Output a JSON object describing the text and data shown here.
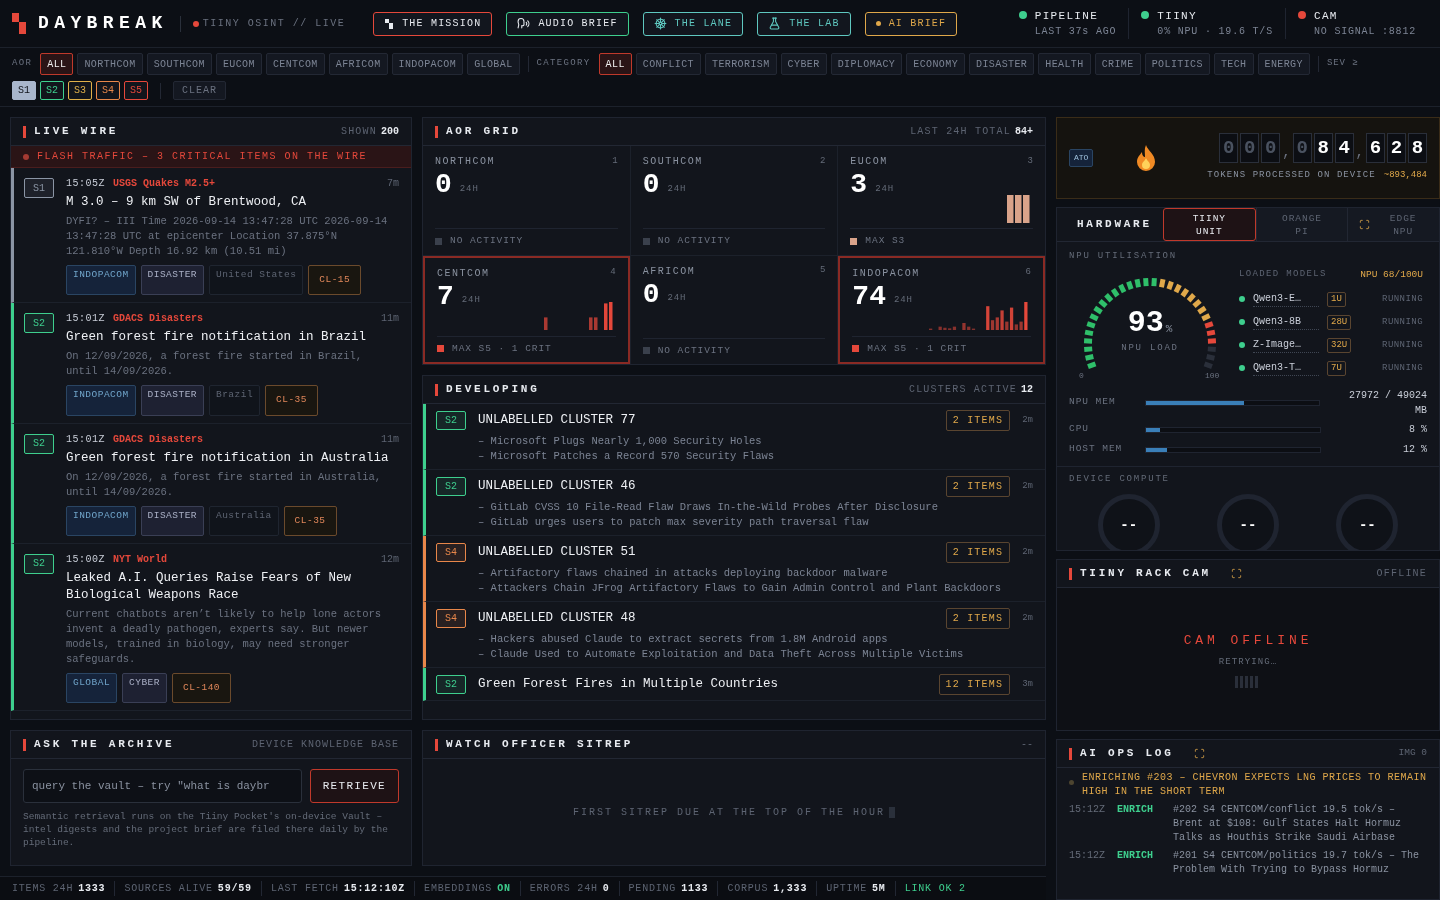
{
  "header": {
    "brand": "DAYBREAK",
    "tagline": "TIINY OSINT // LIVE",
    "nav": [
      {
        "label": "THE MISSION",
        "kind": "mission",
        "color": "#e5483b"
      },
      {
        "label": "AUDIO BRIEF",
        "kind": "audio",
        "color": "#3ecf8e"
      },
      {
        "label": "THE LANE",
        "kind": "lane",
        "color": "#5fc8c0"
      },
      {
        "label": "THE LAB",
        "kind": "lab",
        "color": "#5fc8c0"
      },
      {
        "label": "AI BRIEF",
        "kind": "brief",
        "color": "#e0a84a"
      }
    ],
    "status": [
      {
        "name": "PIPELINE",
        "detail": "LAST 37s AGO",
        "color": "#3ecf8e"
      },
      {
        "name": "TIINY",
        "detail": "0% NPU · 19.6 T/S",
        "color": "#3ecf8e"
      },
      {
        "name": "CAM",
        "detail": "NO SIGNAL :8812",
        "color": "#e5483b"
      }
    ]
  },
  "filters": {
    "aor_label": "AOR",
    "aor": [
      {
        "label": "ALL",
        "selected": true
      },
      {
        "label": "NORTHCOM",
        "selected": false
      },
      {
        "label": "SOUTHCOM",
        "selected": false
      },
      {
        "label": "EUCOM",
        "selected": false
      },
      {
        "label": "CENTCOM",
        "selected": false
      },
      {
        "label": "AFRICOM",
        "selected": false
      },
      {
        "label": "INDOPACOM",
        "selected": false
      },
      {
        "label": "GLOBAL",
        "selected": false
      }
    ],
    "category_label": "CATEGORY",
    "categories": [
      {
        "label": "ALL",
        "selected": true
      },
      {
        "label": "CONFLICT",
        "selected": false
      },
      {
        "label": "TERRORISM",
        "selected": false
      },
      {
        "label": "CYBER",
        "selected": false
      },
      {
        "label": "DIPLOMACY",
        "selected": false
      },
      {
        "label": "ECONOMY",
        "selected": false
      },
      {
        "label": "DISASTER",
        "selected": false
      },
      {
        "label": "HEALTH",
        "selected": false
      },
      {
        "label": "CRIME",
        "selected": false
      },
      {
        "label": "POLITICS",
        "selected": false
      },
      {
        "label": "TECH",
        "selected": false
      },
      {
        "label": "ENERGY",
        "selected": false
      }
    ],
    "sev_label": "SEV ≥",
    "severities": [
      {
        "label": "S1",
        "color": "#a9b6cc",
        "selected": true
      },
      {
        "label": "S2",
        "color": "#3ecf8e",
        "selected": false
      },
      {
        "label": "S3",
        "color": "#e0b04a",
        "selected": false
      },
      {
        "label": "S4",
        "color": "#e8874a",
        "selected": false
      },
      {
        "label": "S5",
        "color": "#e5483b",
        "selected": false
      }
    ],
    "clear": "CLEAR"
  },
  "live_wire": {
    "title": "LIVE WIRE",
    "shown_label": "SHOWN",
    "shown": "200",
    "flash": "FLASH TRAFFIC – 3 CRITICAL ITEMS ON THE WIRE",
    "items": [
      {
        "sev": "S1",
        "color": "#8b95a5",
        "time": "15:05Z",
        "source": "USGS Quakes M2.5+",
        "age": "7m",
        "title": "M 3.0 – 9 km SW of Brentwood, CA",
        "summary": "DYFI? – III Time 2026-09-14 13:47:28 UTC 2026-09-14 13:47:28 UTC at epicenter Location 37.875°N 121.810°W Depth 16.92 km (10.51 mi)",
        "tags": [
          {
            "label": "INDOPACOM",
            "kind": "aor"
          },
          {
            "label": "DISASTER",
            "kind": "category"
          },
          {
            "label": "United States",
            "kind": "place"
          },
          {
            "label": "CL-15",
            "kind": "cluster"
          }
        ]
      },
      {
        "sev": "S2",
        "color": "#3ecf8e",
        "time": "15:01Z",
        "source": "GDACS Disasters",
        "age": "11m",
        "title": "Green forest fire notification in Brazil",
        "summary": "On 12/09/2026, a forest fire started in Brazil, until 14/09/2026.",
        "tags": [
          {
            "label": "INDOPACOM",
            "kind": "aor"
          },
          {
            "label": "DISASTER",
            "kind": "category"
          },
          {
            "label": "Brazil",
            "kind": "place"
          },
          {
            "label": "CL-35",
            "kind": "cluster"
          }
        ]
      },
      {
        "sev": "S2",
        "color": "#3ecf8e",
        "time": "15:01Z",
        "source": "GDACS Disasters",
        "age": "11m",
        "title": "Green forest fire notification in Australia",
        "summary": "On 12/09/2026, a forest fire started in Australia, until 14/09/2026.",
        "tags": [
          {
            "label": "INDOPACOM",
            "kind": "aor"
          },
          {
            "label": "DISASTER",
            "kind": "category"
          },
          {
            "label": "Australia",
            "kind": "place"
          },
          {
            "label": "CL-35",
            "kind": "cluster"
          }
        ]
      },
      {
        "sev": "S2",
        "color": "#3ecf8e",
        "time": "15:00Z",
        "source": "NYT World",
        "age": "12m",
        "title": "Leaked A.I. Queries Raise Fears of New Biological Weapons Race",
        "summary": "Current chatbots aren’t likely to help lone actors invent a deadly pathogen, experts say. But newer models, trained in biology, may need stronger safeguards.",
        "tags": [
          {
            "label": "GLOBAL",
            "kind": "aor"
          },
          {
            "label": "CYBER",
            "kind": "category"
          },
          {
            "label": "CL-140",
            "kind": "cluster"
          }
        ]
      }
    ]
  },
  "aor_grid": {
    "title": "AOR GRID",
    "total_label": "LAST 24H TOTAL",
    "total": "84+",
    "cells": [
      {
        "name": "NORTHCOM",
        "index": "1",
        "count": "0",
        "unit": "24H",
        "footer": "NO ACTIVITY",
        "color": "#3a404c",
        "alert": false
      },
      {
        "name": "SOUTHCOM",
        "index": "2",
        "count": "0",
        "unit": "24H",
        "footer": "NO ACTIVITY",
        "color": "#3a404c",
        "alert": false
      },
      {
        "name": "EUCOM",
        "index": "3",
        "count": "3",
        "unit": "24H",
        "footer": "MAX S3",
        "color": "#d9a38a",
        "alert": false
      },
      {
        "name": "CENTCOM",
        "index": "4",
        "count": "7",
        "unit": "24H",
        "footer": "MAX S5 · 1 CRIT",
        "color": "#e5483b",
        "alert": true
      },
      {
        "name": "AFRICOM",
        "index": "5",
        "count": "0",
        "unit": "24H",
        "footer": "NO ACTIVITY",
        "color": "#3a404c",
        "alert": false
      },
      {
        "name": "INDOPACOM",
        "index": "6",
        "count": "74",
        "unit": "24H",
        "footer": "MAX S5 · 1 CRIT",
        "color": "#e5483b",
        "alert": true
      }
    ]
  },
  "developing": {
    "title": "DEVELOPING",
    "active_label": "CLUSTERS ACTIVE",
    "active": "12",
    "clusters": [
      {
        "sev": "S2",
        "color": "#3ecf8e",
        "title": "UNLABELLED CLUSTER 77",
        "items": "2 ITEMS",
        "age": "2m",
        "lines": [
          "– Microsoft Plugs Nearly 1,000 Security Holes",
          "– Microsoft Patches a Record 570 Security Flaws"
        ]
      },
      {
        "sev": "S2",
        "color": "#3ecf8e",
        "title": "UNLABELLED CLUSTER 46",
        "items": "2 ITEMS",
        "age": "2m",
        "lines": [
          "– GitLab CVSS 10 File-Read Flaw Draws In-the-Wild Probes After Disclosure",
          "– GitLab urges users to patch max severity path traversal flaw"
        ]
      },
      {
        "sev": "S4",
        "color": "#e8874a",
        "title": "UNLABELLED CLUSTER 51",
        "items": "2 ITEMS",
        "age": "2m",
        "lines": [
          "– Artifactory flaws chained in attacks deploying backdoor malware",
          "– Attackers Chain JFrog Artifactory Flaws to Gain Admin Control and Plant Backdoors"
        ]
      },
      {
        "sev": "S4",
        "color": "#e8874a",
        "title": "UNLABELLED CLUSTER 48",
        "items": "2 ITEMS",
        "age": "2m",
        "lines": [
          "– Hackers abused Claude to extract secrets from 1.8M Android apps",
          "– Claude Used to Automate Exploitation and Data Theft Across Multiple Victims"
        ]
      },
      {
        "sev": "S2",
        "color": "#3ecf8e",
        "title": "Green Forest Fires in Multiple Countries",
        "items": "12 ITEMS",
        "age": "3m"
      }
    ]
  },
  "archive": {
    "title": "ASK THE ARCHIVE",
    "subtitle": "DEVICE KNOWLEDGE BASE",
    "placeholder": "query the vault – try \"what is daybr",
    "button": "RETRIEVE",
    "note": "Semantic retrieval runs on the Tiiny Pocket's on-device Vault – intel digests and the project brief are filed there daily by the pipeline."
  },
  "sitrep": {
    "title": "WATCH OFFICER SITREP",
    "status": "--",
    "message": "FIRST SITREP DUE AT THE TOP OF THE HOUR"
  },
  "tokens": {
    "badge": "ATO",
    "counter": [
      "0",
      "0",
      "0",
      ",",
      "0",
      "8",
      "4",
      ",",
      "6",
      "2",
      "8"
    ],
    "label": "TOKENS PROCESSED ON DEVICE",
    "total": "~893,484"
  },
  "hardware": {
    "title": "HARDWARE",
    "tabs": [
      {
        "label": "TIINY UNIT",
        "selected": true,
        "icon": false
      },
      {
        "label": "ORANGE PI",
        "selected": false,
        "icon": false
      },
      {
        "label": "EDGE NPU",
        "selected": false,
        "icon": true
      }
    ],
    "npu_label": "NPU UTILISATION",
    "gauge": {
      "reading": "93",
      "unit": "%",
      "caption": "NPU LOAD",
      "min": "0",
      "max": "100"
    },
    "models_label": "LOADED MODELS",
    "budget": "NPU 68/100U",
    "models": [
      {
        "name": "Qwen3-E…",
        "size": "1U",
        "status": "RUNNING",
        "color": "#3ecf8e"
      },
      {
        "name": "Qwen3-8B",
        "size": "28U",
        "status": "RUNNING",
        "color": "#3ecf8e"
      },
      {
        "name": "Z-Image…",
        "size": "32U",
        "status": "RUNNING",
        "color": "#3ecf8e"
      },
      {
        "name": "Qwen3-T…",
        "size": "7U",
        "status": "RUNNING",
        "color": "#3ecf8e"
      }
    ],
    "meters": [
      {
        "label": "NPU MEM",
        "level": 0.57,
        "reading": "27972 / 49024 MB"
      },
      {
        "label": "CPU",
        "level": 0.08,
        "reading": "8 %"
      },
      {
        "label": "HOST MEM",
        "level": 0.12,
        "reading": "12 %"
      }
    ],
    "compute_label": "DEVICE COMPUTE",
    "dials": [
      "--",
      "--",
      "--"
    ]
  },
  "cam": {
    "title": "TIINY RACK CAM",
    "status": "OFFLINE",
    "message": "CAM OFFLINE",
    "sub": "RETRYING…"
  },
  "ops_log": {
    "title": "AI OPS LOG",
    "img": "IMG 0",
    "current": "ENRICHING #203 – CHEVRON EXPECTS LNG PRICES TO REMAIN HIGH IN THE SHORT TERM",
    "entries": [
      {
        "time": "15:12Z",
        "action": "ENRICH",
        "text": "#202 S4 CENTCOM/conflict 19.5 tok/s – Brent at $108: Gulf States Halt Hormuz Talks as Houthis Strike Saudi Airbase"
      },
      {
        "time": "15:12Z",
        "action": "ENRICH",
        "text": "#201 S4 CENTCOM/politics 19.7 tok/s – The Problem With Trying to Bypass Hormuz"
      }
    ]
  },
  "status_bar": [
    {
      "label": "ITEMS 24H",
      "value": "1333",
      "ok": false
    },
    {
      "label": "SOURCES ALIVE",
      "value": "59/59",
      "ok": false
    },
    {
      "label": "LAST FETCH",
      "value": "15:12:10Z",
      "ok": false
    },
    {
      "label": "EMBEDDINGS",
      "value": "ON",
      "ok": true
    },
    {
      "label": "ERRORS 24H",
      "value": "0",
      "ok": false
    },
    {
      "label": "PENDING",
      "value": "1133",
      "ok": false
    },
    {
      "label": "CORPUS",
      "value": "1,333",
      "ok": false
    },
    {
      "label": "UPTIME",
      "value": "5M",
      "ok": false
    },
    {
      "label": "LINK OK 2",
      "ok": true
    }
  ]
}
